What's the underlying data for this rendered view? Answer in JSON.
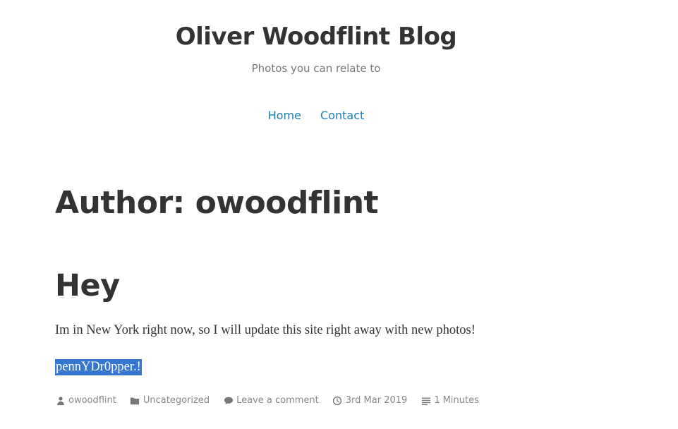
{
  "header": {
    "site_title": "Oliver Woodflint Blog",
    "tagline": "Photos you can relate to"
  },
  "nav": {
    "items": [
      {
        "label": "Home"
      },
      {
        "label": "Contact"
      }
    ]
  },
  "archive": {
    "title": "Author: owoodflint"
  },
  "post": {
    "title": "Hey",
    "body": "Im in New York right now, so I will update this site right away with new photos!",
    "highlighted_text": "pennYDr0pper.!",
    "meta": {
      "author": "owoodflint",
      "category": "Uncategorized",
      "comments": "Leave a comment",
      "date": "3rd Mar 2019",
      "reading_time": "1 Minutes"
    }
  },
  "colors": {
    "link": "#1a7fb8",
    "text": "#333333",
    "muted": "#888888",
    "highlight_bg": "#3576cf"
  },
  "icons": [
    "person-icon",
    "folder-icon",
    "comment-icon",
    "clock-icon",
    "list-icon"
  ]
}
